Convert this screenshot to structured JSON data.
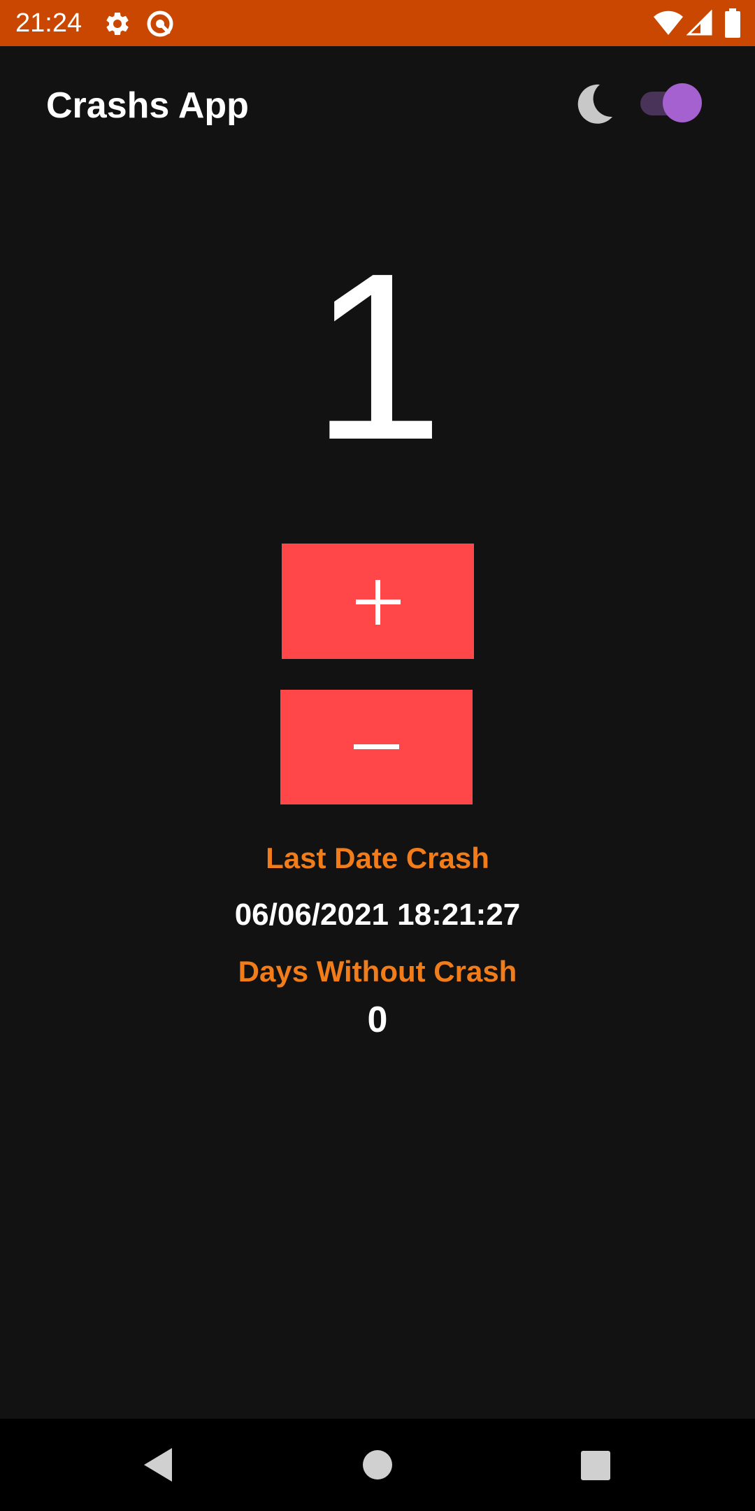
{
  "status_bar": {
    "time": "21:24",
    "background": "#c94700",
    "icons": [
      "settings-icon",
      "vpn-key-icon",
      "wifi-icon",
      "cell-signal-icon",
      "battery-icon"
    ]
  },
  "app": {
    "title": "Crashs App",
    "theme_toggle": {
      "on": true,
      "thumb_color": "#a561cf",
      "track_color": "#4a3358"
    }
  },
  "counter": {
    "value": "1"
  },
  "buttons": {
    "increment_symbol": "+",
    "decrement_symbol": "−",
    "color": "#ff4649"
  },
  "stats": {
    "last_date_label": "Last Date Crash",
    "last_date_value": "06/06/2021 18:21:27",
    "days_label": "Days Without Crash",
    "days_value": "0",
    "label_color": "#f07c1a"
  },
  "nav_bar": {
    "icons": [
      "back-icon",
      "home-icon",
      "recents-icon"
    ]
  }
}
